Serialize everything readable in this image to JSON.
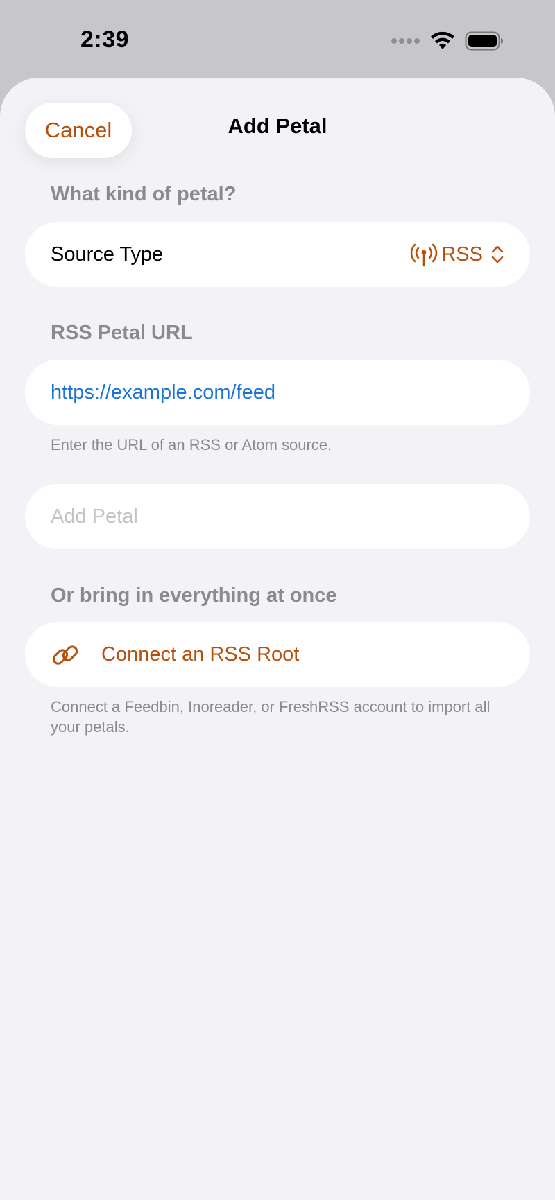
{
  "status_bar": {
    "time": "2:39"
  },
  "sheet": {
    "cancel_label": "Cancel",
    "title": "Add Petal"
  },
  "source_section": {
    "header": "What kind of petal?",
    "row_label": "Source Type",
    "selected_value": "RSS",
    "icon": "antenna-radiowaves-icon"
  },
  "url_section": {
    "header": "RSS Petal URL",
    "input_value": "https://example.com/feed",
    "footer": "Enter the URL of an RSS or Atom source."
  },
  "add_button": {
    "label": "Add Petal",
    "enabled": false
  },
  "root_section": {
    "header": "Or bring in everything at once",
    "connect_label": "Connect an RSS Root",
    "icon": "link-icon",
    "footer": "Connect a Feedbin, Inoreader, or FreshRSS account to import all your petals."
  },
  "colors": {
    "accent": "#b8500b",
    "link_text": "#1a73d9",
    "background": "#f2f2f7",
    "secondary_text": "#8a8a8f"
  }
}
